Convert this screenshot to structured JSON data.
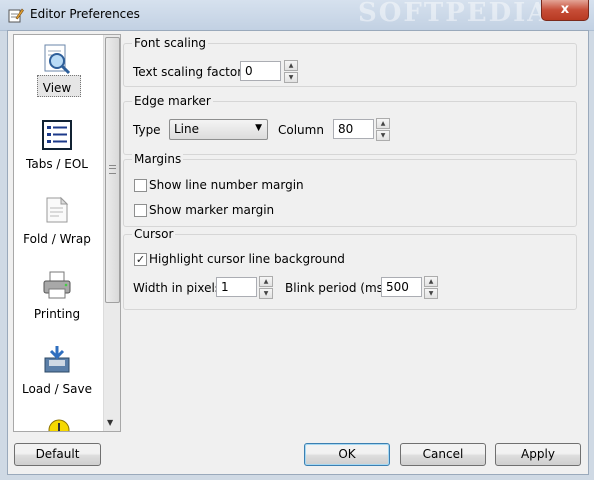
{
  "window": {
    "title": "Editor Preferences",
    "watermark": "SOFTPEDIA",
    "close_label": "x"
  },
  "sidebar": {
    "items": [
      {
        "label": "View",
        "icon": "view-icon"
      },
      {
        "label": "Tabs / EOL",
        "icon": "tabs-icon"
      },
      {
        "label": "Fold / Wrap",
        "icon": "fold-icon"
      },
      {
        "label": "Printing",
        "icon": "printer-icon"
      },
      {
        "label": "Load / Save",
        "icon": "load-save-icon"
      }
    ],
    "selected": "View"
  },
  "font_scaling": {
    "title": "Font scaling",
    "label": "Text scaling factor",
    "value": "0"
  },
  "edge_marker": {
    "title": "Edge marker",
    "type_label": "Type",
    "type_value": "Line",
    "column_label": "Column",
    "column_value": "80"
  },
  "margins": {
    "title": "Margins",
    "line_number_label": "Show line number margin",
    "line_number_checked": false,
    "marker_label": "Show marker margin",
    "marker_checked": false
  },
  "cursor": {
    "title": "Cursor",
    "highlight_label": "Highlight cursor line background",
    "highlight_checked": true,
    "width_label": "Width in pixels",
    "width_value": "1",
    "blink_label": "Blink period (ms)",
    "blink_value": "500"
  },
  "buttons": {
    "default": "Default",
    "ok": "OK",
    "cancel": "Cancel",
    "apply": "Apply"
  },
  "check_mark": "✓",
  "spin_up": "▲",
  "spin_down": "▼",
  "dropdown_arrow": "▼"
}
